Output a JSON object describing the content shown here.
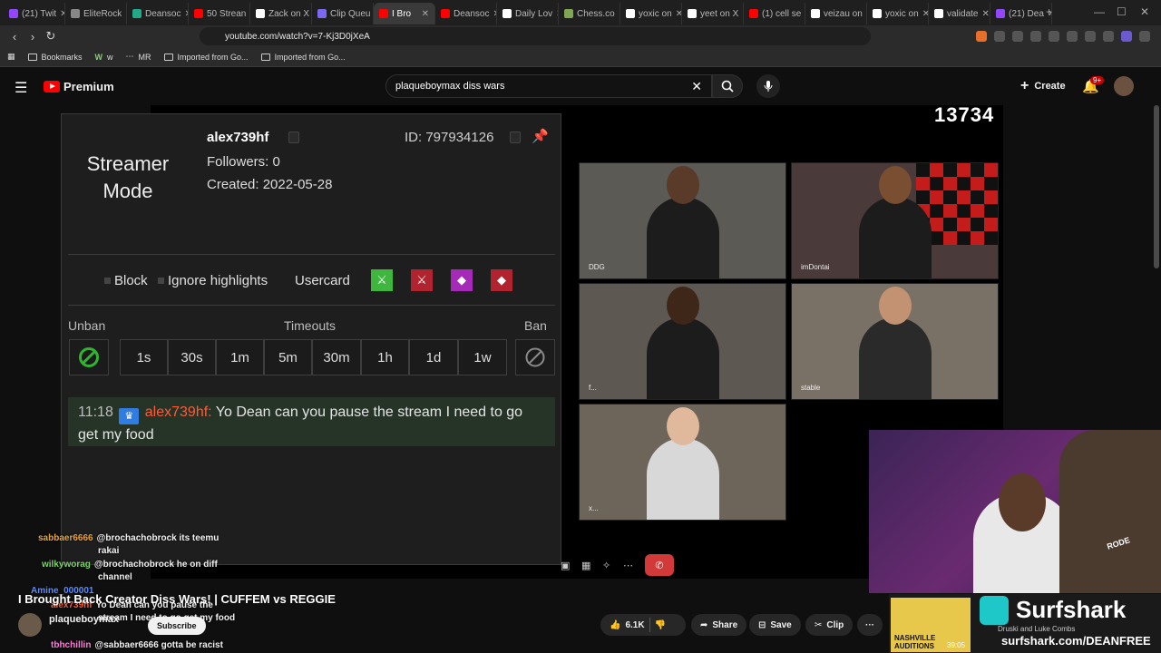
{
  "browser": {
    "tabs": [
      {
        "label": "(21) Twit",
        "color": "#9146ff"
      },
      {
        "label": "EliteRock",
        "color": "#888888"
      },
      {
        "label": "Deansoc",
        "color": "#22aa88"
      },
      {
        "label": "50 Strean",
        "color": "#ff0000"
      },
      {
        "label": "Zack on X",
        "color": "#ffffff"
      },
      {
        "label": "Clip Queu",
        "color": "#7b68ee"
      },
      {
        "label": "I Bro",
        "color": "#ff0000",
        "active": true
      },
      {
        "label": "Deansoc",
        "color": "#ff0000"
      },
      {
        "label": "Daily Lov",
        "color": "#ffffff"
      },
      {
        "label": "Chess.co",
        "color": "#7fa650"
      },
      {
        "label": "yoxic on",
        "color": "#ffffff"
      },
      {
        "label": "yeet on X",
        "color": "#ffffff"
      },
      {
        "label": "(1) cell se",
        "color": "#ff0000"
      },
      {
        "label": "veizau on",
        "color": "#ffffff"
      },
      {
        "label": "yoxic on",
        "color": "#ffffff"
      },
      {
        "label": "validate",
        "color": "#ffffff"
      },
      {
        "label": "(21) Dea",
        "color": "#9146ff"
      }
    ],
    "url": "youtube.com/watch?v=7-Kj3D0jXeA",
    "bookmarks": {
      "bookmarks_label": "Bookmarks",
      "w_label": "w",
      "mr_label": "MR",
      "imported1": "Imported from Go...",
      "imported2": "Imported from Go..."
    }
  },
  "youtube": {
    "logo": "Premium",
    "search_value": "plaqueboymax diss wars",
    "create_label": "Create",
    "notif_count": "9+"
  },
  "stream": {
    "counter": "13734",
    "cams": [
      {
        "label": "DDG"
      },
      {
        "label": "imDontai"
      },
      {
        "label": "f..."
      },
      {
        "label": "stable"
      },
      {
        "label": "x..."
      }
    ],
    "streamer_cam_text": "RODE",
    "sponsor": {
      "brand": "Surfshark",
      "url": "surfshark.com/DEANFREE",
      "small1": "Druski and Luke Combs",
      "time": "39:05",
      "banner": "NASHVILLE AUDITIONS"
    }
  },
  "usercard": {
    "streamer_mode": "Streamer Mode",
    "username": "alex739hf",
    "id_label": "ID: 797934126",
    "followers": "Followers: 0",
    "created": "Created: 2022-05-28",
    "block_label": "Block",
    "ignore_label": "Ignore highlights",
    "usercard_label": "Usercard",
    "unban_label": "Unban",
    "timeouts_label": "Timeouts",
    "ban_label": "Ban",
    "timeouts": [
      "1s",
      "30s",
      "1m",
      "5m",
      "30m",
      "1h",
      "1d",
      "1w"
    ],
    "message": {
      "time": "11:18",
      "user": "alex739hf:",
      "text": "Yo Dean can you pause the stream I need to go get my food"
    }
  },
  "overlay_chat": [
    {
      "user": "sabbaer6666",
      "msg": "@brochachobrock its teemu"
    },
    {
      "user": "",
      "msg": "rakai"
    },
    {
      "user": "wilkyworag",
      "msg": "@brochachobrock he on diff"
    },
    {
      "user": "",
      "msg": "channel"
    },
    {
      "user": "Amine_000001",
      "msg": ""
    },
    {
      "user": "alex739hf",
      "msg": "Yo Dean can you pause the"
    },
    {
      "user": "",
      "msg": "stream I need to go get my food"
    },
    {
      "user": "tbhchillin",
      "msg": "@sabbaer6666 gotta be racist"
    }
  ],
  "video": {
    "title": "I Brought Back Creator Diss Wars! | CUFFEM vs REGGIE",
    "channel": "plaqueboymax",
    "subscribe": "Subscribe",
    "likes": "6.1K",
    "share": "Share",
    "save": "Save",
    "clip": "Clip",
    "more": "···"
  }
}
